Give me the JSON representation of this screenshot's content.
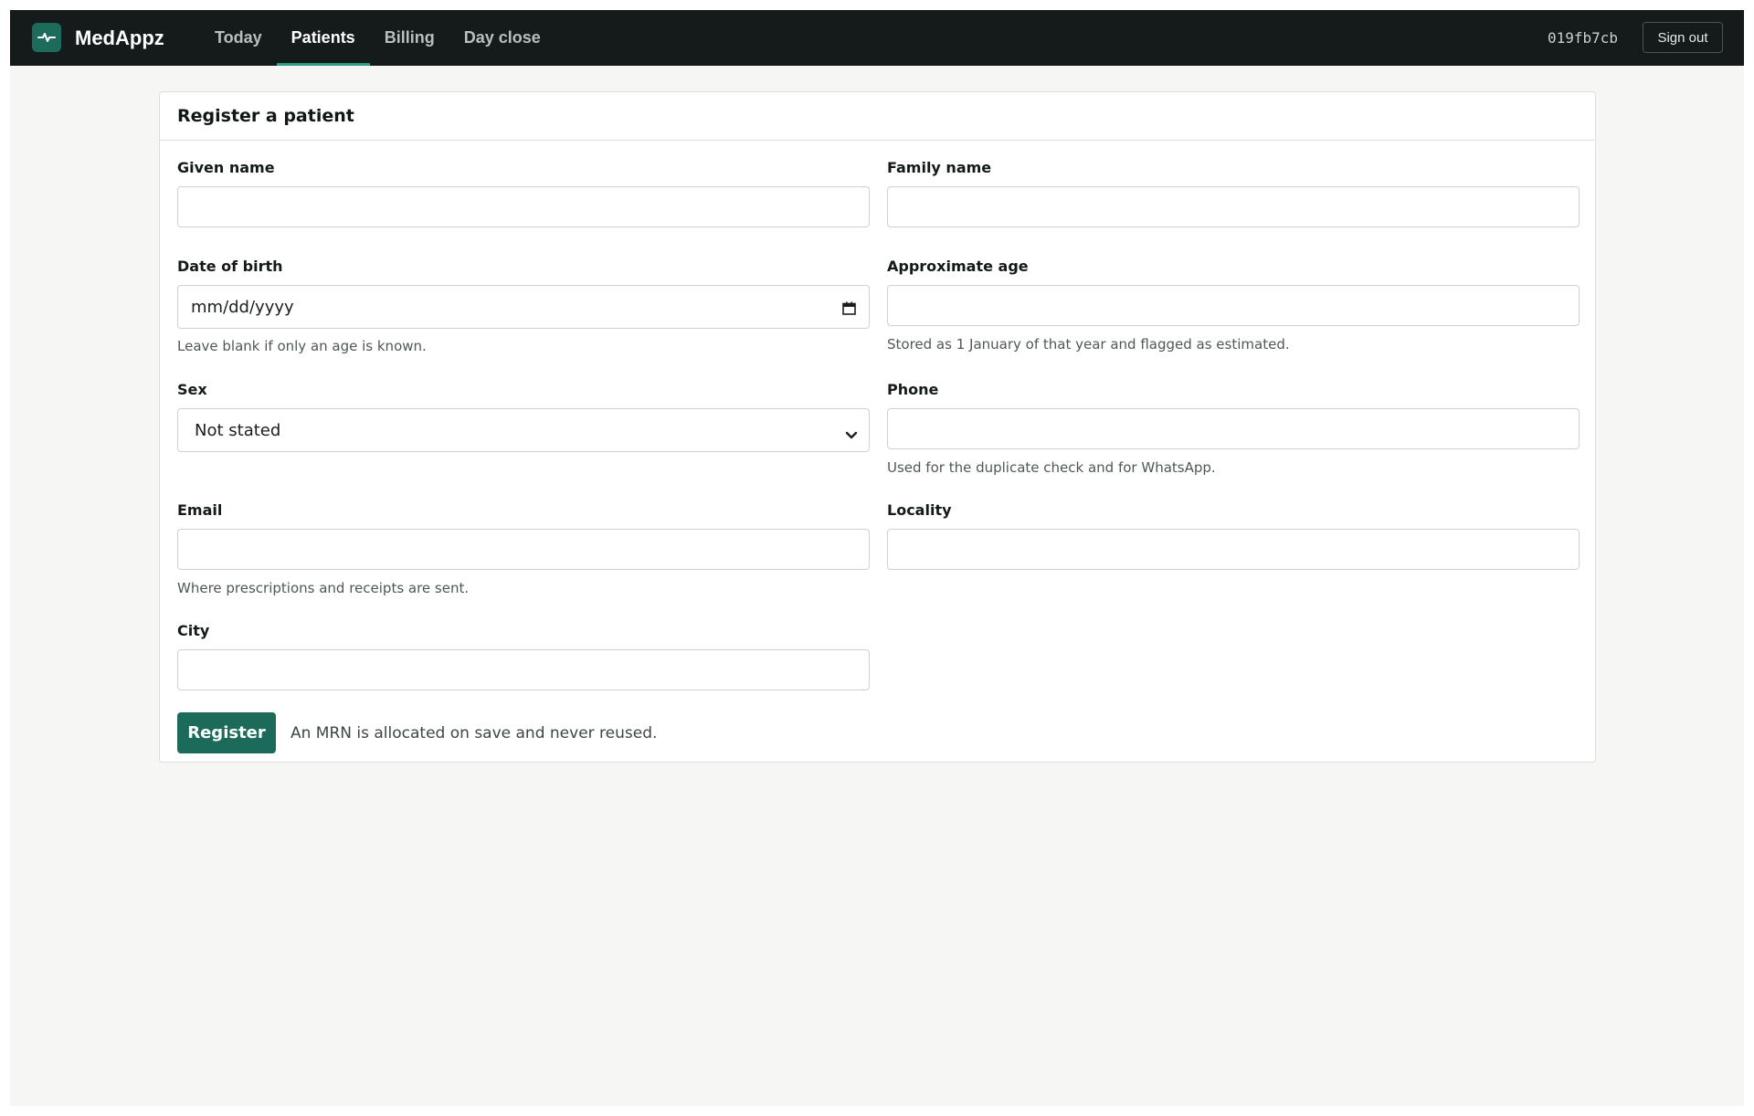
{
  "app": {
    "brand": "MedAppz",
    "build_id": "019fb7cb",
    "sign_out_label": "Sign out",
    "accent_color": "#1d6b5a"
  },
  "nav": {
    "items": [
      {
        "label": "Today",
        "active": false
      },
      {
        "label": "Patients",
        "active": true
      },
      {
        "label": "Billing",
        "active": false
      },
      {
        "label": "Day close",
        "active": false
      }
    ]
  },
  "form": {
    "title": "Register a patient",
    "given_name": {
      "label": "Given name",
      "value": ""
    },
    "family_name": {
      "label": "Family name",
      "value": ""
    },
    "dob": {
      "label": "Date of birth",
      "placeholder": "mm/dd/yyyy",
      "hint": "Leave blank if only an age is known.",
      "icon": "calendar-icon"
    },
    "approx_age": {
      "label": "Approximate age",
      "value": "",
      "hint": "Stored as 1 January of that year and flagged as estimated."
    },
    "sex": {
      "label": "Sex",
      "selected": "Not stated",
      "icon": "chevron-down-icon"
    },
    "phone": {
      "label": "Phone",
      "value": "",
      "hint": "Used for the duplicate check and for WhatsApp."
    },
    "email": {
      "label": "Email",
      "value": "",
      "hint": "Where prescriptions and receipts are sent."
    },
    "locality": {
      "label": "Locality",
      "value": ""
    },
    "city": {
      "label": "City",
      "value": ""
    },
    "submit_label": "Register",
    "submit_note": "An MRN is allocated on save and never reused."
  }
}
